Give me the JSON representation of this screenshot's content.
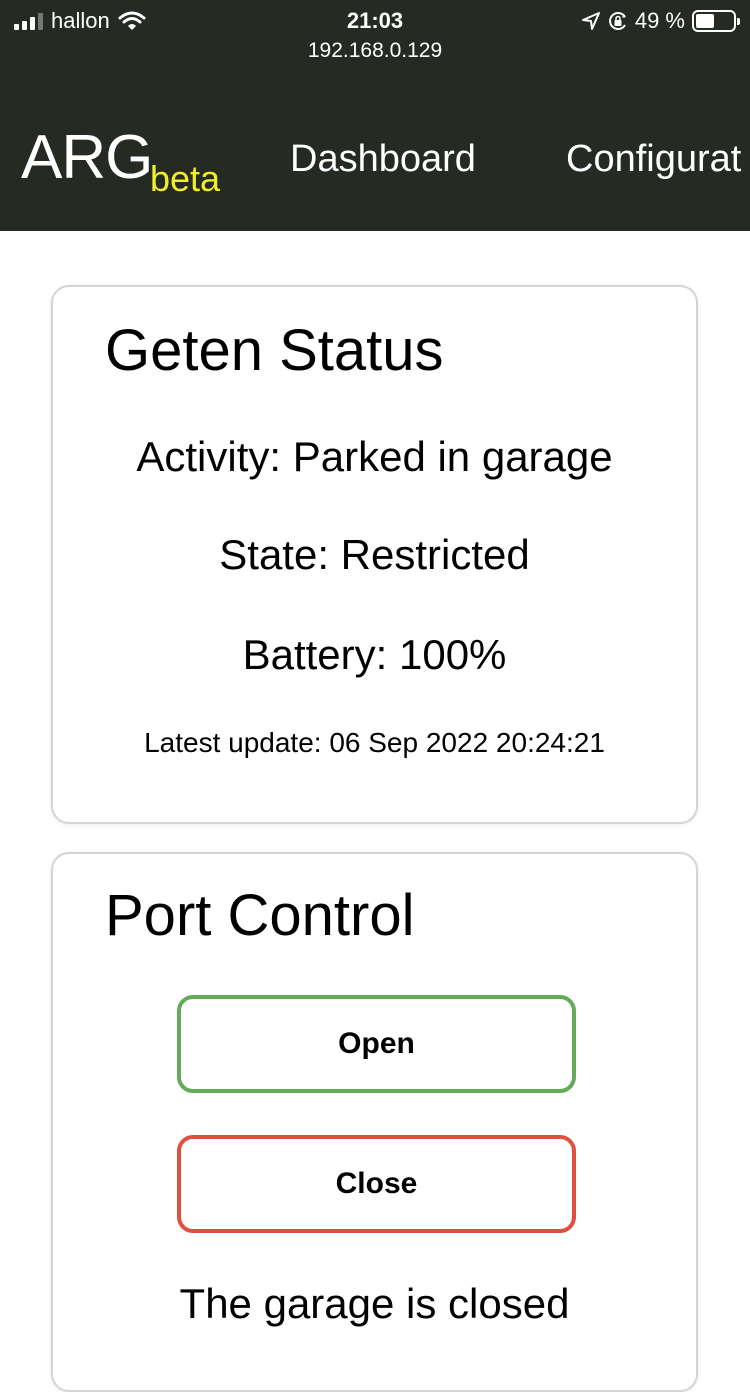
{
  "status_bar": {
    "carrier": "hallon",
    "time": "21:03",
    "url": "192.168.0.129",
    "battery_percent": "49 %",
    "battery_level": 0.49,
    "icons": [
      "cellular-signal-icon",
      "wifi-icon",
      "location-icon",
      "orientation-lock-icon",
      "battery-icon"
    ]
  },
  "nav": {
    "brand": "ARG",
    "brand_sub": "beta",
    "links": [
      "Dashboard",
      "Configurat"
    ]
  },
  "status_card": {
    "title": "Geten Status",
    "activity": "Activity: Parked in garage",
    "state": "State: Restricted",
    "battery": "Battery: 100%",
    "latest_update": "Latest update: 06 Sep 2022 20:24:21"
  },
  "port_control": {
    "title": "Port Control",
    "open_label": "Open",
    "close_label": "Close",
    "garage_status": "The garage is closed"
  },
  "colors": {
    "header_bg": "#252a22",
    "brand_sub": "#f3ee2c",
    "open_border": "#63ab57",
    "close_border": "#dd5140"
  }
}
